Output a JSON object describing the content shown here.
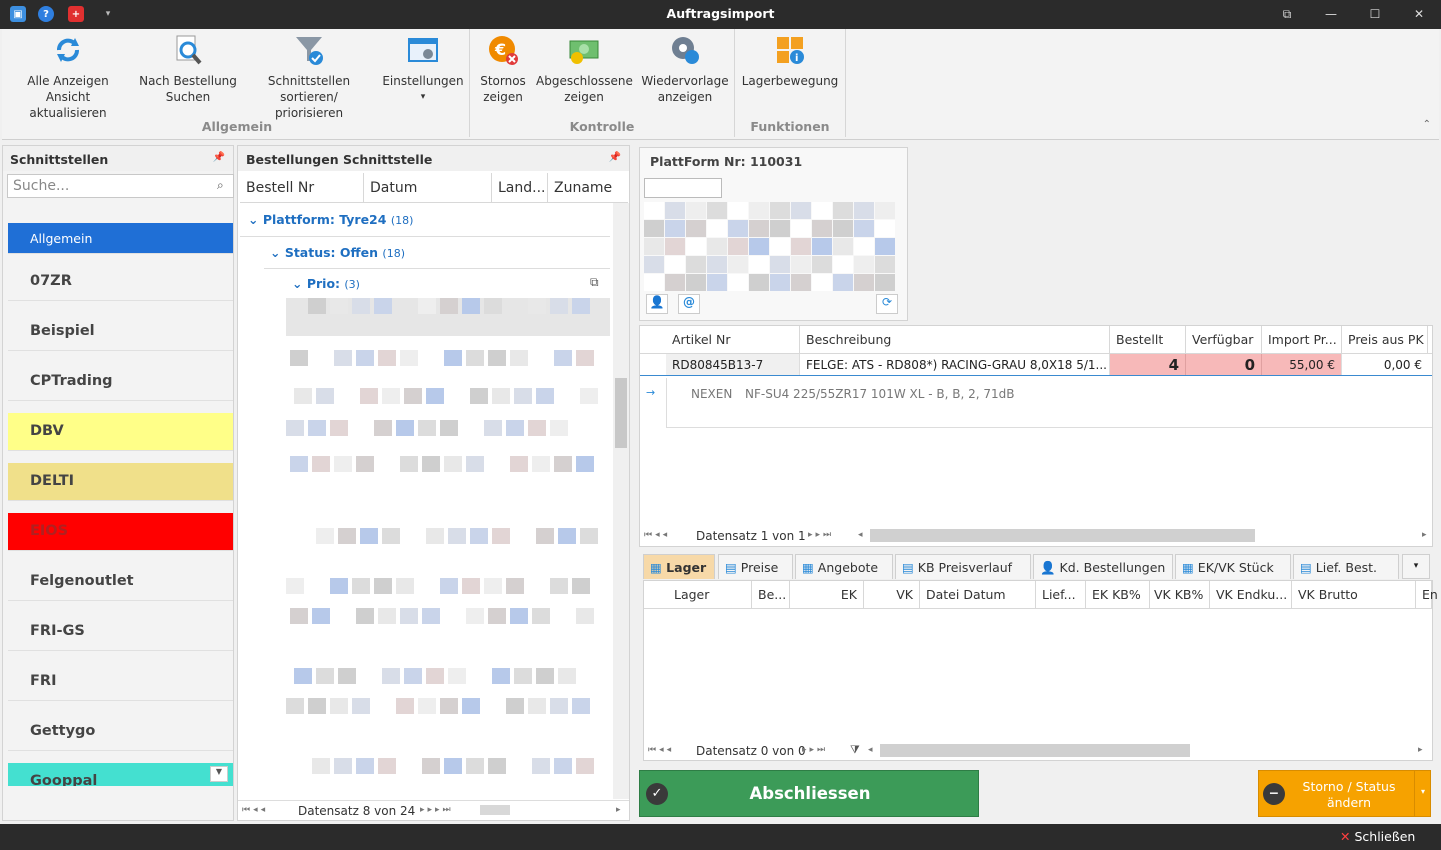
{
  "window": {
    "title": "Auftragsimport"
  },
  "ribbon": {
    "buttons": [
      {
        "label1": "Alle Anzeigen",
        "label2": "Ansicht aktualisieren"
      },
      {
        "label1": "Nach Bestellung",
        "label2": "Suchen"
      },
      {
        "label1": "Schnittstellen",
        "label2": "sortieren/ priorisieren"
      },
      {
        "label1": "Einstellungen",
        "label2": "▾"
      },
      {
        "label1": "Stornos",
        "label2": "zeigen"
      },
      {
        "label1": "Abgeschlossene",
        "label2": "zeigen"
      },
      {
        "label1": "Wiedervorlage",
        "label2": "anzeigen"
      },
      {
        "label1": "Lagerbewegung",
        "label2": ""
      }
    ],
    "groups": [
      "Allgemein",
      "Kontrolle",
      "Funktionen"
    ]
  },
  "interfaces": {
    "title": "Schnittstellen",
    "search_placeholder": "Suche...",
    "items": [
      {
        "label": "Allgemein",
        "bg": "#1f6fd6",
        "fg": "#ffffff"
      },
      {
        "label": "07ZR",
        "bg": "#f3f3f3",
        "fg": "#444444"
      },
      {
        "label": "Beispiel",
        "bg": "#f3f3f3",
        "fg": "#444444"
      },
      {
        "label": "CPTrading",
        "bg": "#f3f3f3",
        "fg": "#444444"
      },
      {
        "label": "DBV",
        "bg": "#ffff88",
        "fg": "#444444"
      },
      {
        "label": "DELTI",
        "bg": "#f0e08a",
        "fg": "#444444"
      },
      {
        "label": "EIOS",
        "bg": "#ff0000",
        "fg": "#b02020"
      },
      {
        "label": "Felgenoutlet",
        "bg": "#f3f3f3",
        "fg": "#444444"
      },
      {
        "label": "FRI-GS",
        "bg": "#f3f3f3",
        "fg": "#444444"
      },
      {
        "label": "FRI",
        "bg": "#f3f3f3",
        "fg": "#444444"
      },
      {
        "label": "Gettygo",
        "bg": "#f3f3f3",
        "fg": "#444444"
      },
      {
        "label": "Gooppal",
        "bg": "#44e0d0",
        "fg": "#444444"
      }
    ]
  },
  "orders": {
    "title": "Bestellungen Schnittstelle",
    "columns": [
      "Bestell Nr",
      "Datum",
      "Land...",
      "Zuname"
    ],
    "group_platform": "Plattform: Tyre24",
    "group_platform_count": "(18)",
    "group_status": "Status: Offen",
    "group_status_count": "(18)",
    "group_prio": "Prio:",
    "group_prio_count": "(3)",
    "nav": "Datensatz 8 von 24"
  },
  "platform": {
    "title": "PlattForm Nr: 110031"
  },
  "articles": {
    "columns": [
      "Artikel Nr",
      "Beschreibung",
      "Bestellt",
      "Verfügbar",
      "Import Pr...",
      "Preis aus PK"
    ],
    "row": {
      "artikel": "RD80845B13-7",
      "beschreibung": "FELGE: ATS - RD808*) RACING-GRAU 8,0X18 5/1...",
      "bestellt": "4",
      "verfuegbar": "0",
      "import": "55,00 €",
      "preis": "0,00 €"
    },
    "detail_brand": "NEXEN",
    "detail_text": "NF-SU4 225/55ZR17 101W XL - B, B, 2, 71dB",
    "nav": "Datensatz 1 von 1"
  },
  "tabs": [
    "Lager",
    "Preise",
    "Angebote",
    "KB Preisverlauf",
    "Kd. Bestellungen",
    "EK/VK Stück",
    "Lief. Best."
  ],
  "stock": {
    "columns": [
      "Lager",
      "Be...",
      "EK",
      "VK",
      "Datei Datum",
      "Lief...",
      "EK KB%",
      "VK KB%",
      "VK Endku...",
      "VK Brutto",
      "En"
    ],
    "nav": "Datensatz 0 von 0"
  },
  "actions": {
    "close_order": "Abschliessen",
    "cancel_1": "Storno / Status",
    "cancel_2": "ändern"
  },
  "statusbar": {
    "close": "Schließen"
  }
}
